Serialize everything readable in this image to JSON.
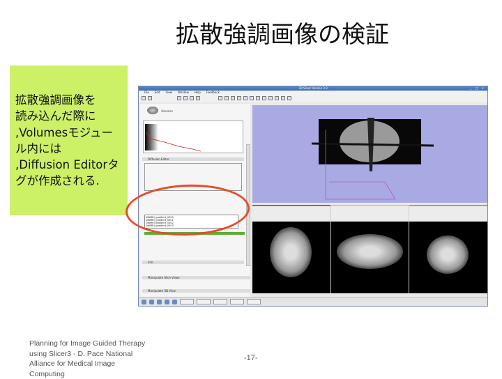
{
  "slide": {
    "title": "拡散強調画像の検証",
    "note": "拡散強調画像を\n読み込んだ際に\n,Volumesモジュー\nル内には\n,Diffusion Editorタ\nグが作成される.",
    "footer": "Planning for Image Guided Therapy using Slicer3 - D. Pace National Alliance for Medical Image Computing",
    "page_number": "-17-"
  },
  "screenshot": {
    "window_title": "3D Slicer Version 3.0",
    "menu": [
      "File",
      "Edit",
      "View",
      "Window",
      "Help",
      "Feedback"
    ],
    "module_name": "Volumes",
    "sections": [
      "Diffusion Editor",
      "Info",
      "Manipulate Slice Views",
      "Manipulate 3D View"
    ],
    "gradients_list": [
      "DWMRI_gradient_0000",
      "DWMRI_gradient_0001",
      "DWMRI_gradient_0002",
      "DWMRI_gradient_0003"
    ],
    "slice_colors": [
      "#e04a3a",
      "#e8d050",
      "#7cc050"
    ],
    "accent": "#ccf066",
    "highlight": "#e84a2a"
  }
}
